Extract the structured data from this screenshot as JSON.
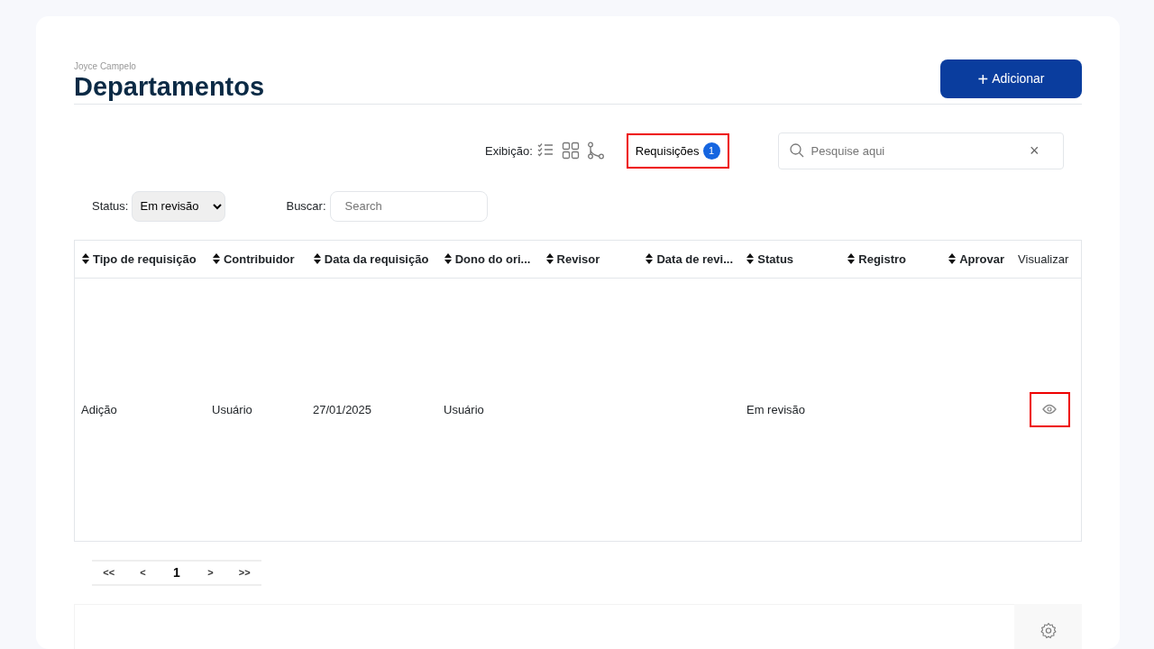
{
  "header": {
    "user": "Joyce Campelo",
    "title": "Departamentos",
    "add_button": {
      "icon": "+",
      "label": "Adicionar"
    }
  },
  "toolbar": {
    "view_label": "Exibição:",
    "view_modes": [
      {
        "kind": "list"
      },
      {
        "kind": "grid"
      },
      {
        "kind": "tree"
      }
    ],
    "requests": {
      "label": "Requisições",
      "count": "1",
      "highlighted": true
    },
    "search": {
      "placeholder": "Pesquise aqui",
      "clear": "×"
    }
  },
  "filters": {
    "status_label": "Status:",
    "status_value": "Em revisão",
    "search_label": "Buscar:",
    "search_placeholder": "Search"
  },
  "table": {
    "columns": [
      {
        "label": "Tipo de requisição",
        "sortable": true
      },
      {
        "label": "Contribuidor",
        "sortable": true
      },
      {
        "label": "Data da requisição",
        "sortable": true
      },
      {
        "label": "Dono do ori...",
        "sortable": true
      },
      {
        "label": "Revisor",
        "sortable": true
      },
      {
        "label": "Data de revi...",
        "sortable": true
      },
      {
        "label": "Status",
        "sortable": true
      },
      {
        "label": "Registro",
        "sortable": true
      },
      {
        "label": "Aprovar",
        "sortable": true
      },
      {
        "label": "Visualizar",
        "sortable": false
      }
    ],
    "rows": [
      {
        "cells": [
          "Adição",
          "Usuário",
          "27/01/2025",
          "Usuário",
          "",
          "",
          "Em revisão",
          "",
          ""
        ],
        "view_highlighted": true
      }
    ]
  },
  "pagination": [
    {
      "label": "<<",
      "selected": false
    },
    {
      "label": "<",
      "selected": false
    },
    {
      "label": "1",
      "selected": true
    },
    {
      "label": ">",
      "selected": false
    },
    {
      "label": ">>",
      "selected": false
    }
  ]
}
